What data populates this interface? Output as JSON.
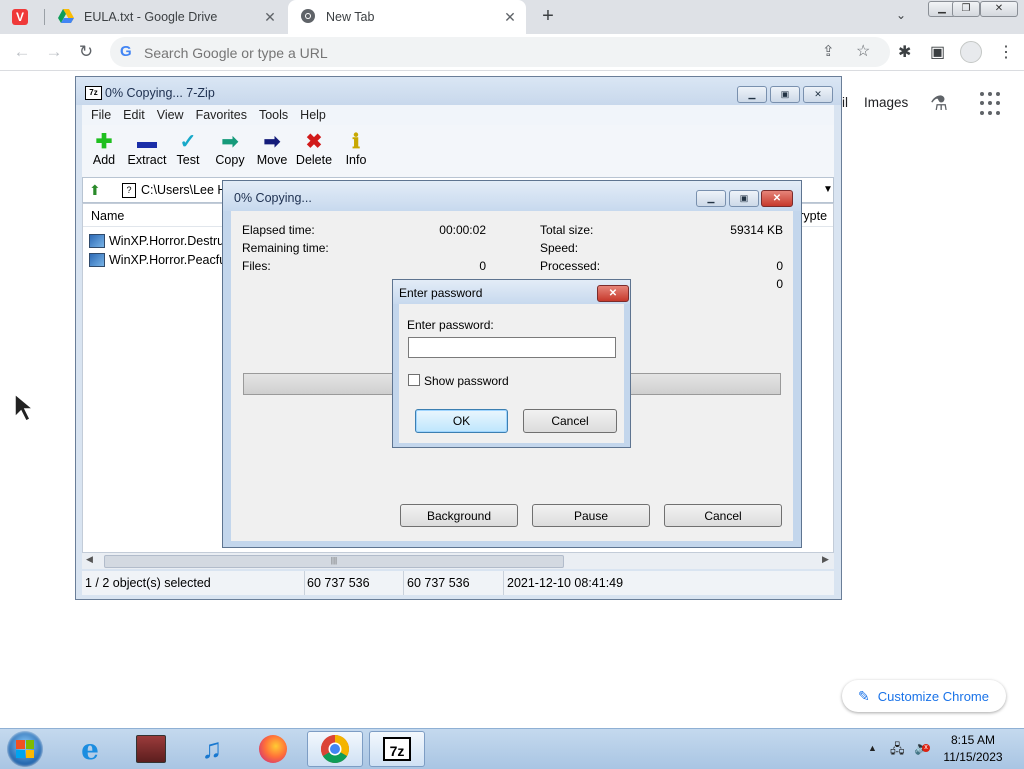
{
  "browser": {
    "tabs": [
      {
        "title": "EULA.txt - Google Drive",
        "icon": "google-drive-icon"
      },
      {
        "title": "New Tab",
        "icon": "chrome-icon"
      }
    ],
    "omnibox": {
      "placeholder": "Search Google or type a URL"
    },
    "ntp": {
      "gmail": "il",
      "images": "Images",
      "customize": "Customize Chrome"
    }
  },
  "zip": {
    "title": "0% Copying... 7-Zip",
    "menu": [
      "File",
      "Edit",
      "View",
      "Favorites",
      "Tools",
      "Help"
    ],
    "toolbar": [
      {
        "label": "Add",
        "icon": "plus-icon",
        "color": "#1fbf1f",
        "glyph": "✚"
      },
      {
        "label": "Extract",
        "icon": "minus-icon",
        "color": "#1a2ea8",
        "glyph": "▬"
      },
      {
        "label": "Test",
        "icon": "check-icon",
        "color": "#17a9c9",
        "glyph": "✓"
      },
      {
        "label": "Copy",
        "icon": "copy-arrow-icon",
        "color": "#159a7a",
        "glyph": "➡"
      },
      {
        "label": "Move",
        "icon": "move-arrow-icon",
        "color": "#141c7a",
        "glyph": "➡"
      },
      {
        "label": "Delete",
        "icon": "delete-x-icon",
        "color": "#d11a1a",
        "glyph": "✖"
      },
      {
        "label": "Info",
        "icon": "info-icon",
        "color": "#c8a800",
        "glyph": "ℹ"
      }
    ],
    "path": "C:\\Users\\Lee Ha",
    "columns": {
      "name": "Name",
      "crypted": "crypte"
    },
    "files": [
      "WinXP.Horror.Destruc",
      "WinXP.Horror.Peacful"
    ],
    "status": {
      "selected": "1 / 2 object(s) selected",
      "size": "60 737 536",
      "packed": "60 737 536",
      "modified": "2021-12-10 08:41:49"
    }
  },
  "copy_dialog": {
    "title": "0% Copying...",
    "elapsed_label": "Elapsed time:",
    "elapsed_value": "00:00:02",
    "remaining_label": "Remaining time:",
    "files_label": "Files:",
    "files_value": "0",
    "total_label": "Total size:",
    "total_value": "59314 KB",
    "speed_label": "Speed:",
    "processed_label": "Processed:",
    "processed_value": "0",
    "extra_value": "0",
    "progress_percent": 0,
    "buttons": {
      "background": "Background",
      "pause": "Pause",
      "cancel": "Cancel"
    }
  },
  "password_dialog": {
    "title": "Enter password",
    "label": "Enter password:",
    "value": "",
    "show_password": "Show password",
    "ok": "OK",
    "cancel": "Cancel"
  },
  "taskbar": {
    "apps": [
      "internet-explorer-icon",
      "media-center-icon",
      "itunes-icon",
      "firefox-icon",
      "chrome-icon",
      "7zip-icon"
    ],
    "time": "8:15 AM",
    "date": "11/15/2023"
  }
}
